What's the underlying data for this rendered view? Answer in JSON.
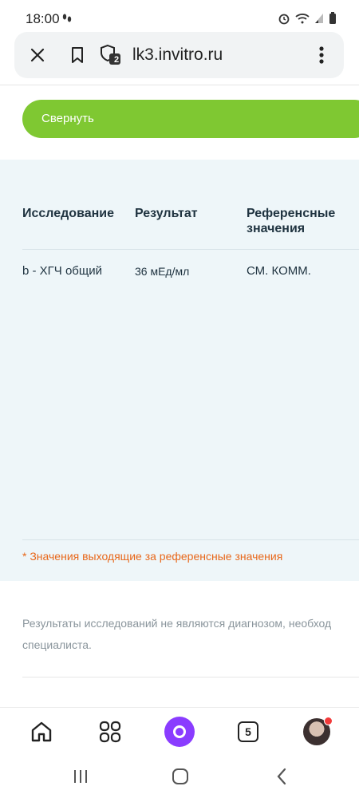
{
  "status_bar": {
    "time": "18:00"
  },
  "browser": {
    "url": "lk3.invitro.ru",
    "tab_badge": "2",
    "icons": {
      "close": "close-icon",
      "bookmark": "bookmark-icon",
      "security": "shield-icon",
      "menu": "more-vertical-icon"
    }
  },
  "collapse_button": {
    "label": "Свернуть"
  },
  "results_table": {
    "headers": {
      "study": "Исследование",
      "result": "Результат",
      "reference_line1": "Референсные",
      "reference_line2": "значения"
    },
    "rows": [
      {
        "study": "b - ХГЧ общий",
        "result": "36 мЕд/мл",
        "reference": "СМ. КОММ."
      }
    ],
    "note": "* Значения выходящие за референсные значения"
  },
  "disclaimer": {
    "line1": "Результаты исследований не являются диагнозом, необход",
    "line2": "специалиста."
  },
  "toolbar": {
    "tabs_count": "5"
  },
  "colors": {
    "accent_green": "#7fc832",
    "panel_bg": "#eef6f9",
    "note_orange": "#e8681b",
    "alice_purple": "#8a3cff"
  }
}
